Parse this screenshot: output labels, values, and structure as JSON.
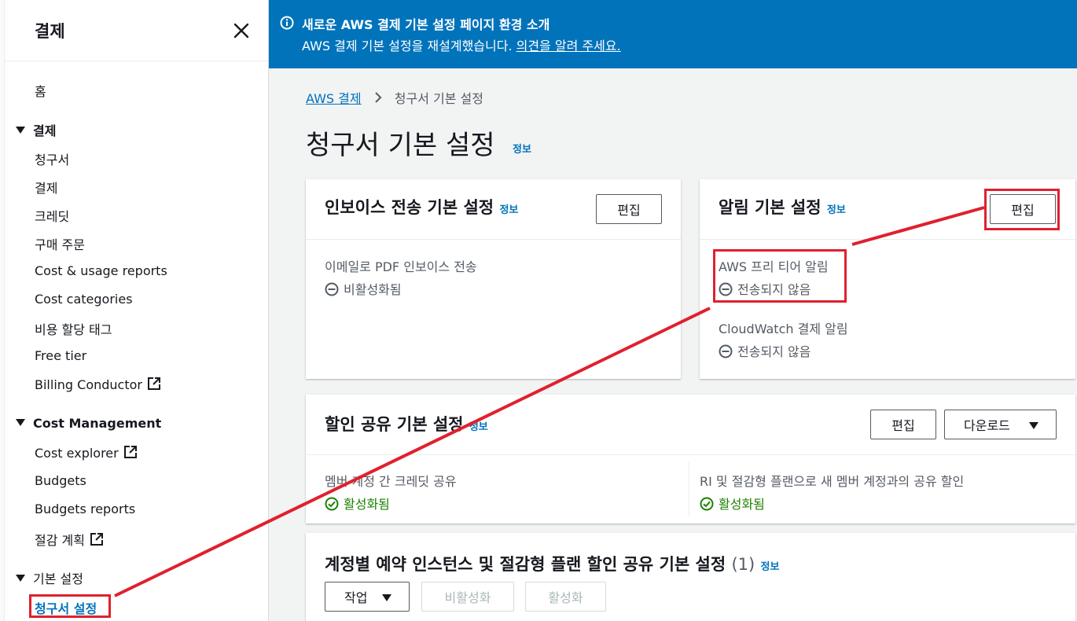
{
  "sidebar": {
    "title": "결제",
    "items": [
      {
        "label": "홈"
      },
      {
        "section": "결제"
      },
      {
        "label": "청구서"
      },
      {
        "label": "결제"
      },
      {
        "label": "크레딧"
      },
      {
        "label": "구매 주문"
      },
      {
        "label": "Cost & usage reports"
      },
      {
        "label": "Cost categories"
      },
      {
        "label": "비용 할당 태그"
      },
      {
        "label": "Free tier"
      },
      {
        "label": "Billing Conductor"
      },
      {
        "section": "Cost Management"
      },
      {
        "label": "Cost explorer"
      },
      {
        "label": "Budgets"
      },
      {
        "label": "Budgets reports"
      },
      {
        "label": "절감 계획"
      },
      {
        "section": "기본 설정"
      },
      {
        "label": "청구서 설정"
      }
    ]
  },
  "banner": {
    "title": "새로운 AWS 결제 기본 설정 페이지 환경 소개",
    "text": "AWS 결제 기본 설정을 재설계했습니다. ",
    "link": "의견을 알려 주세요."
  },
  "breadcrumb": {
    "parent": "AWS 결제",
    "current": "청구서 기본 설정"
  },
  "page": {
    "title": "청구서 기본 설정",
    "info": "정보"
  },
  "invoice_card": {
    "title": "인보이스 전송 기본 설정",
    "info": "정보",
    "edit": "편집",
    "field_label": "이메일로 PDF 인보이스 전송",
    "field_status": "비활성화됨"
  },
  "alert_card": {
    "title": "알림 기본 설정",
    "info": "정보",
    "edit": "편집",
    "field1_label": "AWS 프리 티어 알림",
    "field1_status": "전송되지 않음",
    "field2_label": "CloudWatch 결제 알림",
    "field2_status": "전송되지 않음"
  },
  "discount_card": {
    "title": "할인 공유 기본 설정",
    "info": "정보",
    "edit": "편집",
    "download": "다운로드",
    "field1_label": "멤버 계정 간 크레딧 공유",
    "field1_status": "활성화됨",
    "field2_label": "RI 및 절감형 플랜으로 새 멤버 계정과의 공유 할인",
    "field2_status": "활성화됨"
  },
  "ri_card": {
    "title": "계정별 예약 인스턴스 및 절감형 플랜 할인 공유 기본 설정",
    "count": "(1)",
    "info": "정보",
    "actions": "작업",
    "deactivate": "비활성화",
    "activate": "활성화"
  },
  "colors": {
    "accent": "#0073bb",
    "highlight": "#e0202e",
    "success": "#1d8102"
  }
}
